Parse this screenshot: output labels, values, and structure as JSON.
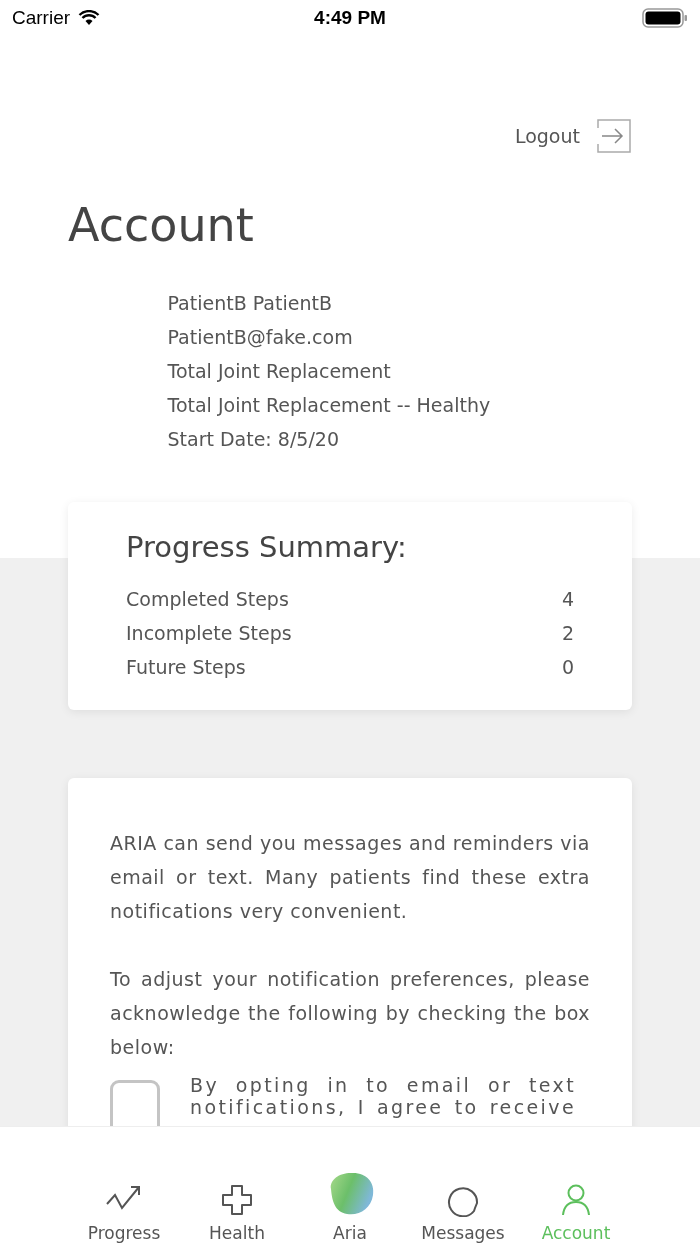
{
  "status_bar": {
    "carrier": "Carrier",
    "time": "4:49 PM"
  },
  "logout": {
    "label": "Logout"
  },
  "title": "Account",
  "profile": [
    "PatientB PatientB",
    "PatientB@fake.com",
    "Total Joint Replacement",
    "Total Joint Replacement -- Healthy",
    "Start Date: 8/5/20"
  ],
  "progress_summary": {
    "title": "Progress Summary:",
    "rows": [
      {
        "label": "Completed Steps",
        "value": "4"
      },
      {
        "label": "Incomplete Steps",
        "value": "2"
      },
      {
        "label": "Future Steps",
        "value": "0"
      }
    ]
  },
  "notifications": {
    "paragraphs": [
      "ARIA can send you messages and reminders via email or text. Many patients find these extra notifications very convenient.",
      "To adjust your notification preferences, please acknowledge the following by checking the box below:"
    ],
    "consent": {
      "checked": false,
      "text": "By opting in to email or text notifications, I agree to receive"
    }
  },
  "tab_bar": [
    {
      "kind": "progress",
      "label": "Progress",
      "selected": false
    },
    {
      "kind": "health",
      "label": "Health",
      "selected": false
    },
    {
      "kind": "aria",
      "label": "Aria",
      "selected": false
    },
    {
      "kind": "messages",
      "label": "Messages",
      "selected": false
    },
    {
      "kind": "account",
      "label": "Account",
      "selected": true
    }
  ]
}
